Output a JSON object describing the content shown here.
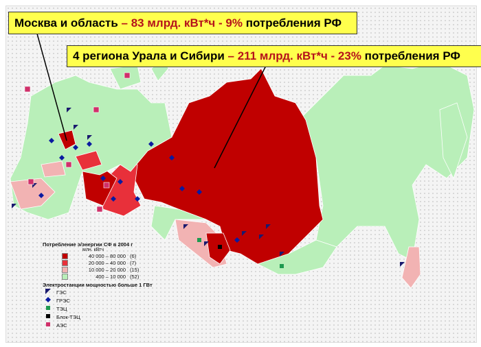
{
  "callouts": [
    {
      "pre": "Москва и область ",
      "highlight": "– 83 млрд. кВт*ч - 9%",
      "post": " потребления РФ"
    },
    {
      "pre": "4 региона Урала и Сибири ",
      "highlight": "– 211 млрд. кВт*ч - 23%",
      "post": " потребления РФ"
    }
  ],
  "legend": {
    "title": "Потребление э/энергии СФ в 2004 г",
    "unit": "млн. кВтч",
    "classes": [
      {
        "range": "40 000 – 80 000",
        "count": "(6)",
        "color": "#c00000"
      },
      {
        "range": "20 000 – 40 000",
        "count": "(7)",
        "color": "#e8303a"
      },
      {
        "range": "10 000 – 20 000",
        "count": "(15)",
        "color": "#f2b3b3"
      },
      {
        "range": "400 – 10 000",
        "count": "(52)",
        "color": "#b9efb9"
      }
    ],
    "plants_title": "Электростанции мощностью больше 1 ГВт",
    "plants": [
      {
        "label": "ГЭС",
        "icon": "hydro-triangle-icon",
        "color": "#1a1a6e"
      },
      {
        "label": "ГРЭС",
        "icon": "diamond-icon",
        "color": "#0a1aa0"
      },
      {
        "label": "ТЭЦ",
        "icon": "green-square-icon",
        "color": "#1e9a50"
      },
      {
        "label": "Блок-ТЭЦ",
        "icon": "black-square-icon",
        "color": "#000000"
      },
      {
        "label": "АЭС",
        "icon": "pink-square-icon",
        "color": "#d0306a"
      }
    ]
  }
}
